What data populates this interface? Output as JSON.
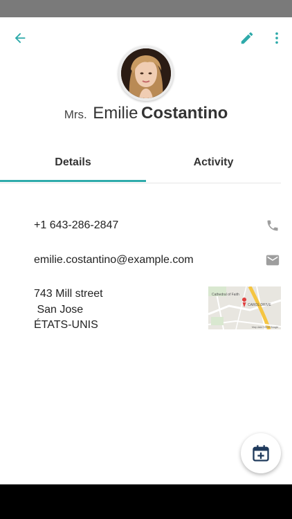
{
  "contact": {
    "title": "Mrs.",
    "first_name": "Emilie",
    "last_name": "Costantino"
  },
  "tabs": [
    {
      "label": "Details",
      "active": true
    },
    {
      "label": "Activity",
      "active": false
    }
  ],
  "details": {
    "phone": "+1 643-286-2847",
    "email": "emilie.costantino@example.com",
    "address": {
      "street": "743 Mill street",
      "city": " San Jose",
      "country": "ÉTATS-UNIS"
    }
  },
  "map": {
    "labels": [
      "Cathedral of Faith",
      "CAROL DRIVE"
    ],
    "attribution": "Map data ©2018 Google"
  },
  "icons": {
    "back": "arrow-left-icon",
    "edit": "pencil-icon",
    "more": "more-vert-icon",
    "phone": "phone-icon",
    "email": "mail-icon",
    "fab": "calendar-add-icon"
  },
  "colors": {
    "accent": "#2eaaaa",
    "status_bar": "#7a7a7a",
    "icon_muted": "#9e9e9e",
    "fab_icon": "#1f3a5c"
  }
}
